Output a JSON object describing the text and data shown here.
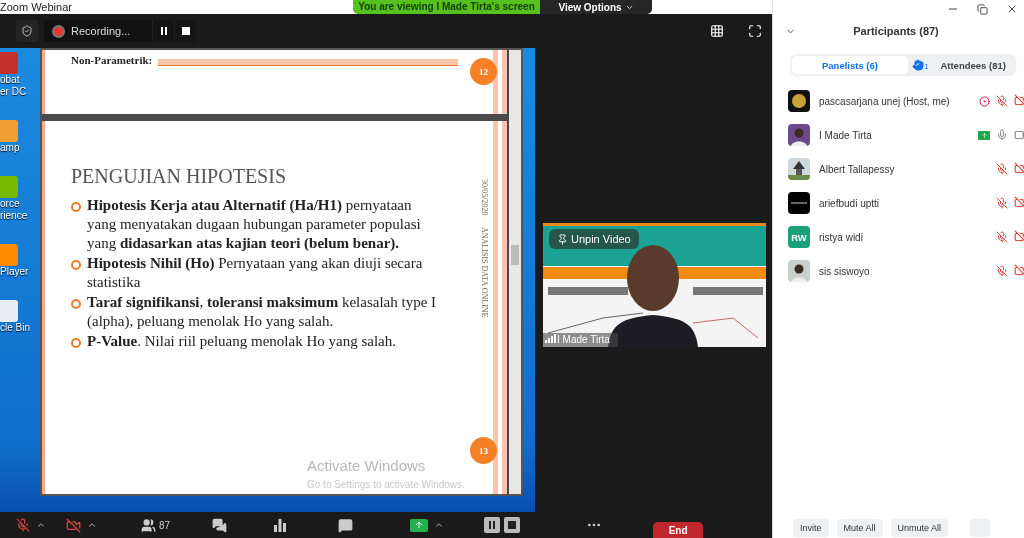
{
  "window": {
    "title": "Zoom Webinar"
  },
  "banner": {
    "text": "You are viewing I Made Tirta's screen",
    "view_options": "View Options"
  },
  "recording": {
    "label": "Recording..."
  },
  "desktop": {
    "icons": [
      {
        "lines": [
          "obat",
          "er DC"
        ],
        "color": "#c4302b"
      },
      {
        "lines": [
          "amp"
        ],
        "color": "#f0a030"
      },
      {
        "lines": [
          "orce",
          "rience"
        ],
        "color": "#76b900"
      },
      {
        "lines": [
          "Player"
        ],
        "color": "#ff8a00"
      },
      {
        "lines": [
          "cle Bin"
        ],
        "color": "#e8eef5"
      }
    ]
  },
  "slides": {
    "prev": {
      "text": "Non-Parametrik:",
      "page": "12"
    },
    "current": {
      "title": "PENGUJIAN HIPOTESIS",
      "date": "30/05/2020",
      "footer": "ANALISIS DATA ONLINE",
      "page": "13",
      "bullets": [
        "**Hipotesis Kerja atau Alternatif (Ha/H1)** pernyataan yang menyatakan dugaan hubungan parameter populasi yang **didasarkan atas kajian teori (belum benar).**",
        "**Hipotesis  Nihil (Ho)** Pernyataan yang akan diuji secara statistika",
        "**Taraf signifikansi**, **toleransi maksimum** kelasalah type I (alpha), peluang menolak Ho yang salah.",
        "**P-Value**. Nilai riil peluang menolak Ho yang salah."
      ]
    },
    "watermark": {
      "title": "Activate Windows",
      "subtitle": "Go to Settings to activate Windows."
    }
  },
  "video": {
    "unpin": "Unpin Video",
    "name": "I Made Tirta"
  },
  "participants": {
    "title": "Participants (87)",
    "tabs": [
      {
        "label": "Panelists (6)",
        "selected": true
      },
      {
        "label": "Attendees (81)",
        "selected": false
      }
    ],
    "raised_hands": "1",
    "people": [
      {
        "name": "pascasarjana unej (Host, me)",
        "avatar": {
          "kind": "logo"
        },
        "status": {
          "kind": "record"
        },
        "mic_muted": true,
        "video_off": true
      },
      {
        "name": "I Made Tirta",
        "status": {
          "kind": "share"
        },
        "mic_muted": false,
        "video_off": false
      },
      {
        "name": "Albert Tallapessy",
        "avatar": {
          "kind": "temple"
        },
        "mic_muted": true,
        "video_off": true
      },
      {
        "name": "ariefbudi uptti",
        "avatar": {
          "kind": "dark"
        },
        "mic_muted": true,
        "video_off": true
      },
      {
        "name": "ristya widi",
        "avatar": {
          "kind": "initials",
          "initials": "RW"
        },
        "mic_muted": true,
        "video_off": true
      },
      {
        "name": "sis siswoyo",
        "mic_muted": true,
        "video_off": true
      }
    ],
    "buttons": [
      "Invite",
      "Mute All",
      "Unmute All"
    ]
  },
  "toolbar": {
    "mic_muted": true,
    "video_off": true,
    "participant_count": "87",
    "end": "End"
  }
}
